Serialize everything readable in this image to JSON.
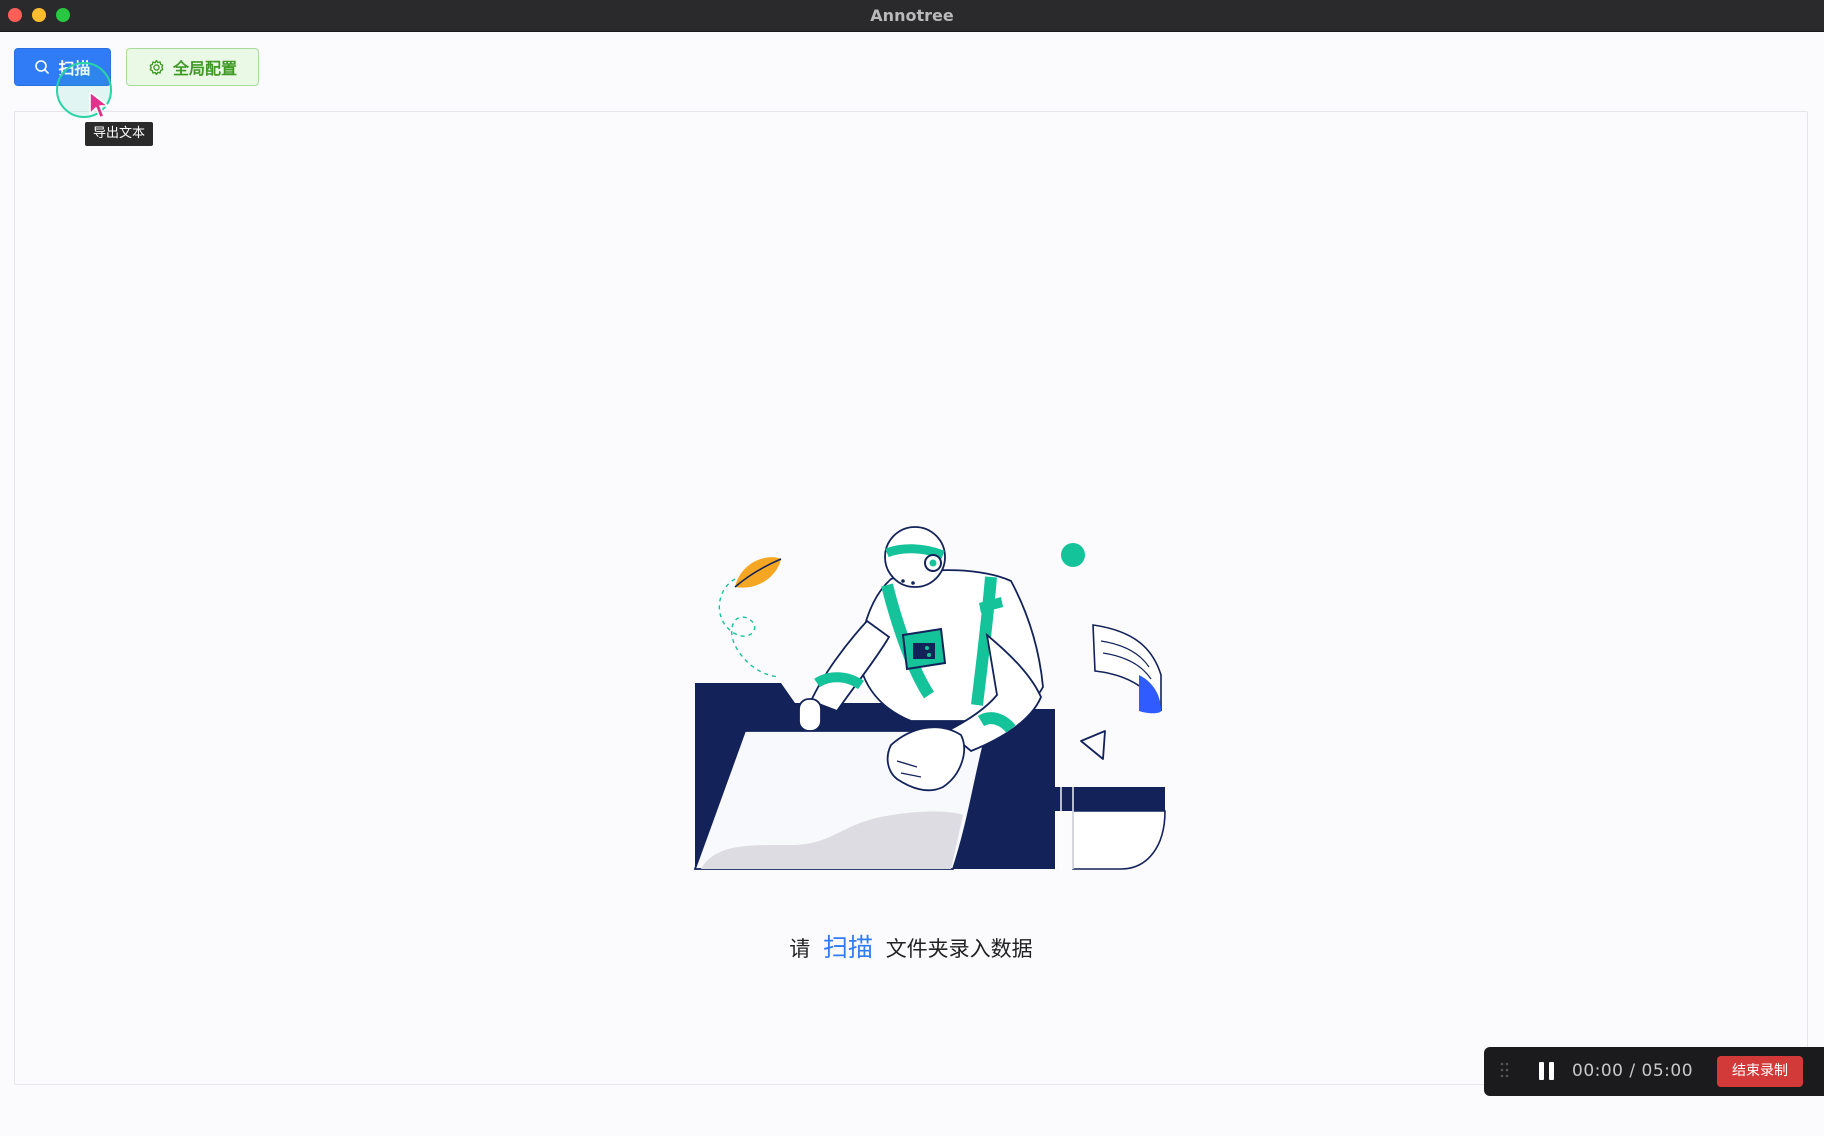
{
  "window": {
    "title": "Annotree"
  },
  "toolbar": {
    "scan_label": "扫描",
    "config_label": "全局配置"
  },
  "tooltip": {
    "text": "导出文本"
  },
  "empty_state": {
    "prefix": "请",
    "link": "扫描",
    "suffix": "文件夹录入数据"
  },
  "recorder": {
    "elapsed": "00:00",
    "separator": "/",
    "total": "05:00",
    "stop_label": "结束录制"
  },
  "colors": {
    "primary": "#2f7cf6",
    "success": "#3f9a25",
    "navy": "#13235a",
    "teal": "#14c39a",
    "danger": "#d23a3a"
  }
}
